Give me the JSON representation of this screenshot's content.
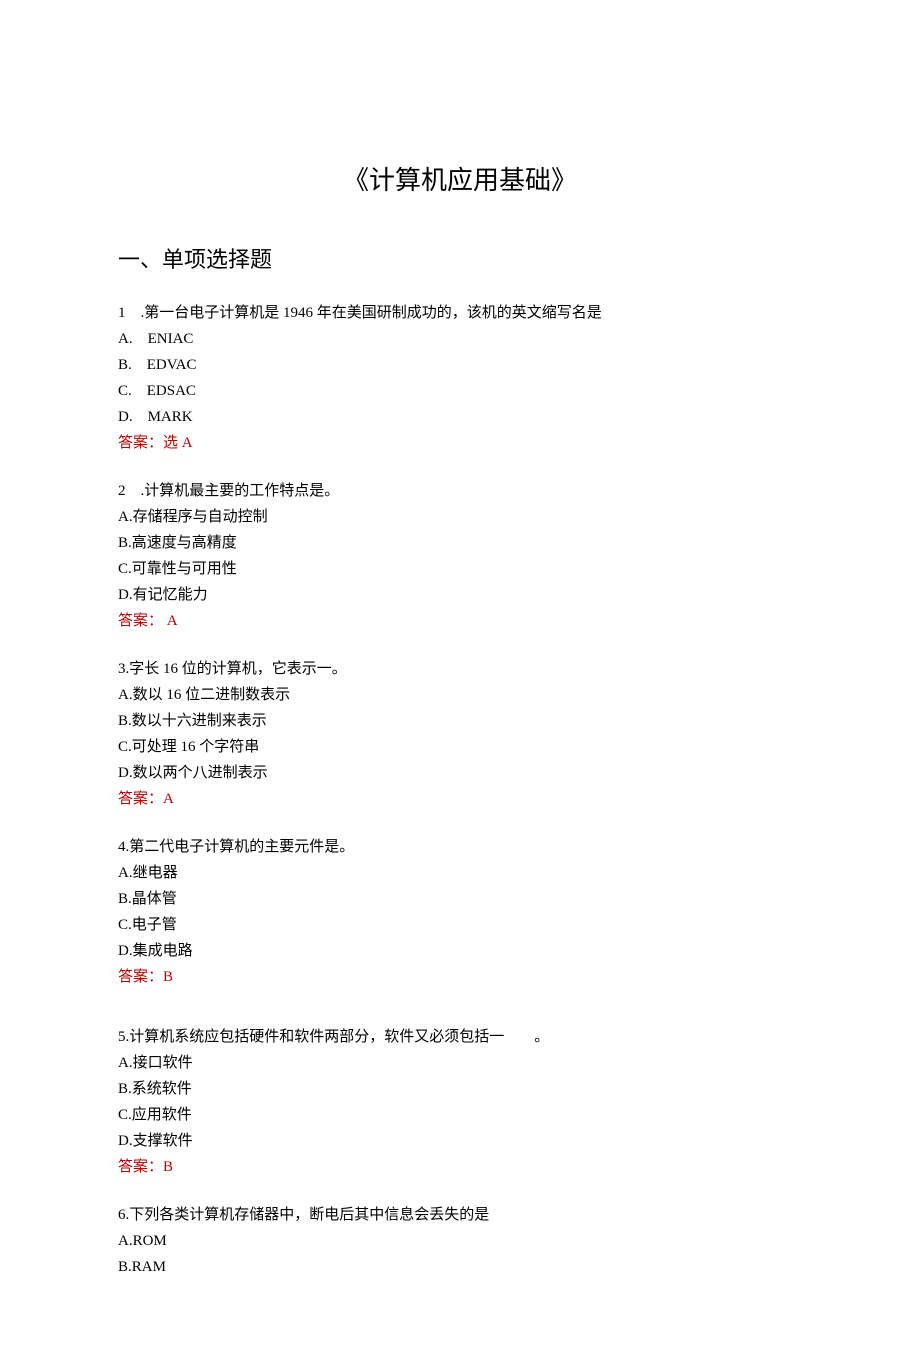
{
  "title": "《计算机应用基础》",
  "section_heading": "一、单项选择题",
  "questions": [
    {
      "number": "1 .",
      "text": "第一台电子计算机是 1946 年在美国研制成功的，该机的英文缩写名是",
      "options": [
        {
          "label": "A. ",
          "text": "ENIAC"
        },
        {
          "label": "B. ",
          "text": "EDVAC"
        },
        {
          "label": "C. ",
          "text": "EDSAC"
        },
        {
          "label": "D. ",
          "text": "MARK"
        }
      ],
      "answer_prefix": "答案：",
      "answer": "选 A"
    },
    {
      "number": "2 .",
      "text": "计算机最主要的工作特点是。",
      "options": [
        {
          "label": "A.",
          "text": "存储程序与自动控制"
        },
        {
          "label": "B.",
          "text": "高速度与高精度"
        },
        {
          "label": "C.",
          "text": "可靠性与可用性"
        },
        {
          "label": "D.",
          "text": "有记忆能力"
        }
      ],
      "answer_prefix": "答案：",
      "answer": " A"
    },
    {
      "number": "3.",
      "text": "字长 16 位的计算机，它表示一。",
      "options": [
        {
          "label": "A.",
          "text": "数以 16 位二进制数表示"
        },
        {
          "label": "B.",
          "text": "数以十六进制来表示"
        },
        {
          "label": "C.",
          "text": "可处理 16 个字符串"
        },
        {
          "label": "D.",
          "text": "数以两个八进制表示"
        }
      ],
      "answer_prefix": "答案：",
      "answer": "A"
    },
    {
      "number": "4.",
      "text": "第二代电子计算机的主要元件是。",
      "options": [
        {
          "label": "A.",
          "text": "继电器"
        },
        {
          "label": "B.",
          "text": "晶体管"
        },
        {
          "label": "C.",
          "text": "电子管"
        },
        {
          "label": "D.",
          "text": "集成电路"
        }
      ],
      "answer_prefix": "答案：",
      "answer": "B"
    },
    {
      "number": "5.",
      "text": "计算机系统应包括硬件和软件两部分，软件又必须包括一  。",
      "options": [
        {
          "label": "A.",
          "text": "接口软件"
        },
        {
          "label": "B.",
          "text": "系统软件"
        },
        {
          "label": "C.",
          "text": "应用软件"
        },
        {
          "label": "D.",
          "text": "支撑软件"
        }
      ],
      "answer_prefix": "答案：",
      "answer": "B"
    },
    {
      "number": "6.",
      "text": "下列各类计算机存储器中，断电后其中信息会丢失的是",
      "options": [
        {
          "label": " A.",
          "text": "ROM"
        },
        {
          "label": "B.",
          "text": "RAM"
        }
      ],
      "answer_prefix": "",
      "answer": ""
    }
  ]
}
